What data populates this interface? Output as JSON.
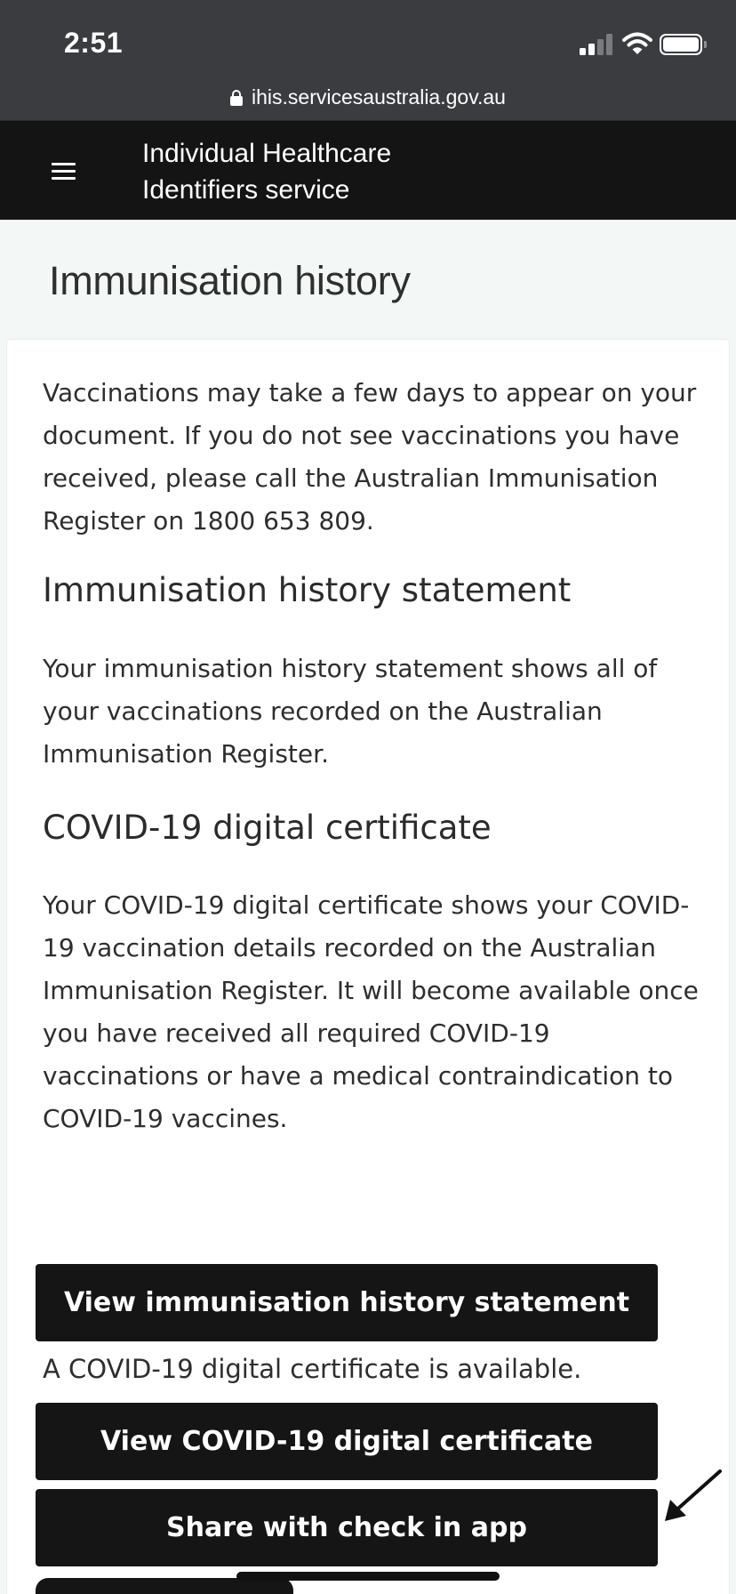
{
  "status_bar": {
    "time": "2:51",
    "url": "ihis.servicesaustralia.gov.au",
    "icons": [
      "signal-icon",
      "wifi-icon",
      "battery-icon",
      "lock-icon"
    ]
  },
  "header": {
    "title_line1": "Individual Healthcare",
    "title_line2": "Identifiers service",
    "menu_icon": "menu-icon"
  },
  "page": {
    "title": "Immunisation history",
    "intro": "Vaccinations may take a few days to appear on your document. If you do not see vaccinations you have received, please call the Australian Immunisation Register on 1800 653 809.",
    "sections": [
      {
        "heading": "Immunisation history statement",
        "body": "Your immunisation history statement shows all of your vaccinations recorded on the Australian Immunisation Register."
      },
      {
        "heading": "COVID-19 digital certificate",
        "body": "Your COVID-19 digital certificate shows your COVID-19 vaccination details recorded on the Australian Immunisation Register. It will become available once you have received all required COVID-19 vaccinations or have a medical contraindication to COVID-19 vaccines."
      }
    ],
    "buttons": {
      "view_statement": "View immunisation history statement",
      "view_certificate": "View COVID-19 digital certificate",
      "share_checkin": "Share with check in app"
    },
    "certificate_available": "A COVID-19 digital certificate is available."
  },
  "colors": {
    "status_bar_bg": "#3b3c40",
    "header_bg": "#141414",
    "page_bg": "#f3f7f6",
    "button_bg": "#151515",
    "button_text": "#ffffff"
  }
}
